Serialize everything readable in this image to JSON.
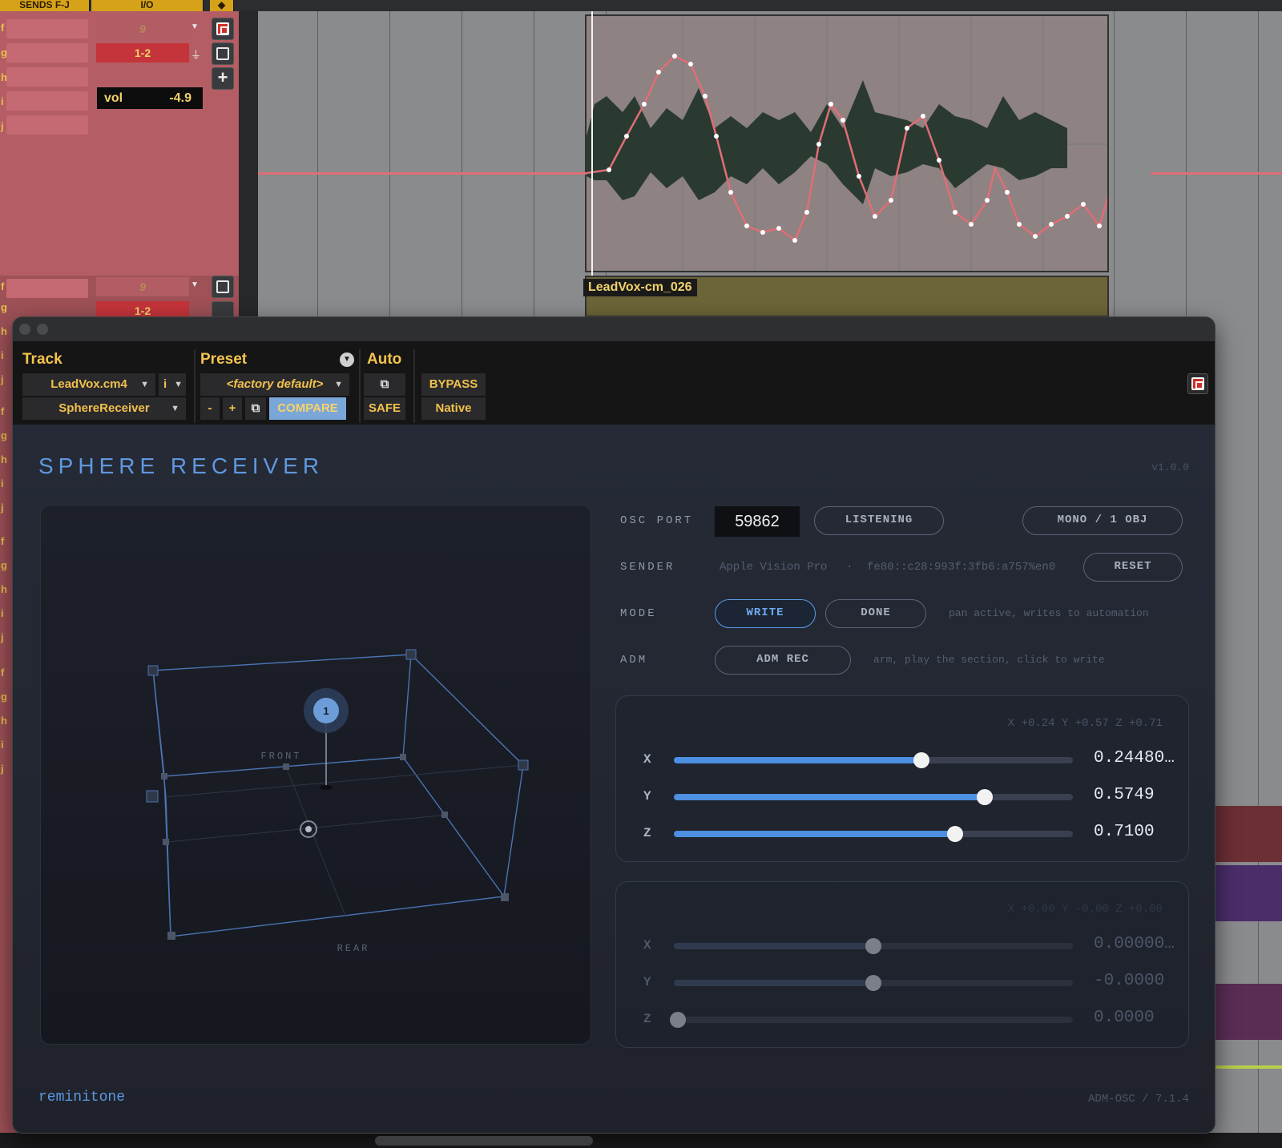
{
  "daw": {
    "header": {
      "sends": "SENDS F-J",
      "io": "I/O"
    },
    "send_letters": [
      "f",
      "g",
      "h",
      "i",
      "j"
    ],
    "track1": {
      "send_value": "9",
      "io_output": "1-2",
      "vol_label": "vol",
      "vol_value": "-4.9"
    },
    "track2": {
      "send_value": "9",
      "io_output": "1-2"
    },
    "side_letters": [
      "f",
      "g",
      "h",
      "i",
      "j",
      "f",
      "g",
      "h",
      "i",
      "j",
      "f",
      "g",
      "h",
      "i",
      "j",
      "f",
      "g",
      "h",
      "i",
      "j"
    ],
    "region_name": "LeadVox-cm_026",
    "colors": {
      "track_red": "#b45d64",
      "automation_line": "#e06e75",
      "waveform": "#2c3a33",
      "region": "#8e8283"
    }
  },
  "plugin": {
    "header": {
      "track_label": "Track",
      "preset_label": "Preset",
      "auto_label": "Auto",
      "track_name": "LeadVox.cm4",
      "track_channel": "i",
      "plugin_name": "SphereReceiver",
      "preset_name": "<factory default>",
      "minus": "-",
      "plus": "+",
      "compare": "COMPARE",
      "bypass": "BYPASS",
      "safe": "SAFE",
      "native": "Native"
    },
    "title": "SPHERE RECEIVER",
    "version": "v1.0.0",
    "viewport": {
      "front_label": "FRONT",
      "rear_label": "REAR",
      "object_number": "1"
    },
    "osc_port_label": "OSC PORT",
    "osc_port_value": "59862",
    "listening": "LISTENING",
    "mono_mode": "MONO / 1 OBJ",
    "sender_label": "SENDER",
    "sender_device": "Apple Vision Pro",
    "sender_sep": "·",
    "sender_address": "fe80::c28:993f:3fb6:a757%en0",
    "reset": "RESET",
    "mode_label": "MODE",
    "write": "WRITE",
    "done": "DONE",
    "mode_hint": "pan active, writes to automation",
    "adm_label": "ADM",
    "adm_rec": "ADM REC",
    "adm_hint": "arm, play the section, click to write",
    "object1": {
      "coords": "X +0.24   Y +0.57   Z +0.71",
      "axes": [
        "X",
        "Y",
        "Z"
      ],
      "values": [
        "0.24480…",
        "0.5749",
        "0.7100"
      ],
      "positions": [
        0.62,
        0.78,
        0.705
      ]
    },
    "object2": {
      "coords": "X +0.00   Y -0.00   Z +0.00",
      "axes": [
        "X",
        "Y",
        "Z"
      ],
      "values": [
        "0.00000…",
        "-0.0000",
        "0.0000"
      ],
      "positions": [
        0.5,
        0.5,
        0.01
      ]
    },
    "footer_brand": "reminitone",
    "footer_format": "ADM-OSC / 7.1.4",
    "colors": {
      "accent": "#5c9be8",
      "title": "#5f98e0",
      "header_yellow": "#f4c44d",
      "compare_bg": "#7ba7d8"
    }
  }
}
